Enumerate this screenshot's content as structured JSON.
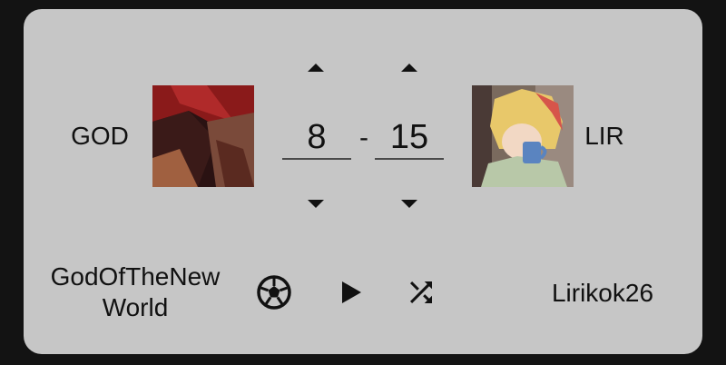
{
  "player_left": {
    "short_name": "GOD",
    "full_name_line1": "GodOfTheNew",
    "full_name_line2": "World",
    "avatar_icon": "anime-avatar-red-hair"
  },
  "player_right": {
    "short_name": "LIR",
    "full_name": "Lirikok26",
    "avatar_icon": "anime-avatar-blonde-mug"
  },
  "score": {
    "left": "8",
    "separator": "-",
    "right": "15"
  },
  "actions": {
    "ball_icon": "soccer-ball-icon",
    "play_icon": "play-icon",
    "shuffle_icon": "shuffle-icon"
  },
  "colors": {
    "card_bg": "#c6c6c6",
    "page_bg": "#131313",
    "text": "#111111"
  }
}
